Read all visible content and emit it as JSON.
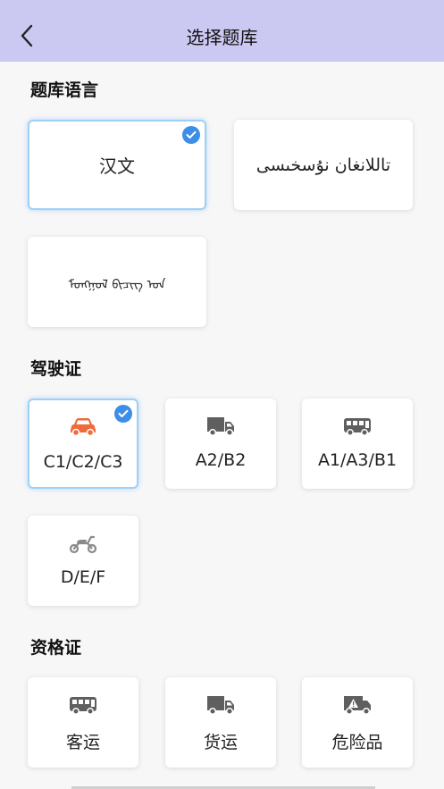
{
  "header": {
    "title": "选择题库",
    "back_icon": "back-chevron-icon",
    "background": "#cbc8f2"
  },
  "sections": {
    "language": {
      "title": "题库语言",
      "items": [
        {
          "label": "汉文",
          "selected": true
        },
        {
          "label": "تاللانغان نۇسخىسى",
          "selected": false
        },
        {
          "label": "ᠮᠣᠩᠭᠣᠯ ᠪᠢᠴᠢᠭ᠌ ᠤᠨ",
          "selected": false
        }
      ]
    },
    "license": {
      "title": "驾驶证",
      "items": [
        {
          "label": "C1/C2/C3",
          "icon": "car-icon",
          "selected": true
        },
        {
          "label": "A2/B2",
          "icon": "truck-icon",
          "selected": false
        },
        {
          "label": "A1/A3/B1",
          "icon": "bus-icon",
          "selected": false
        },
        {
          "label": "D/E/F",
          "icon": "motorcycle-icon",
          "selected": false
        }
      ]
    },
    "qualification": {
      "title": "资格证",
      "items": [
        {
          "label": "客运",
          "icon": "bus-icon",
          "selected": false
        },
        {
          "label": "货运",
          "icon": "truck-icon",
          "selected": false
        },
        {
          "label": "危险品",
          "icon": "hazard-truck-icon",
          "selected": false
        }
      ]
    }
  },
  "colors": {
    "accent": "#3d8ee6",
    "selected_border": "#9fd0f4",
    "car_icon": "#f06a3c",
    "gray_icon": "#5f5f5f"
  }
}
